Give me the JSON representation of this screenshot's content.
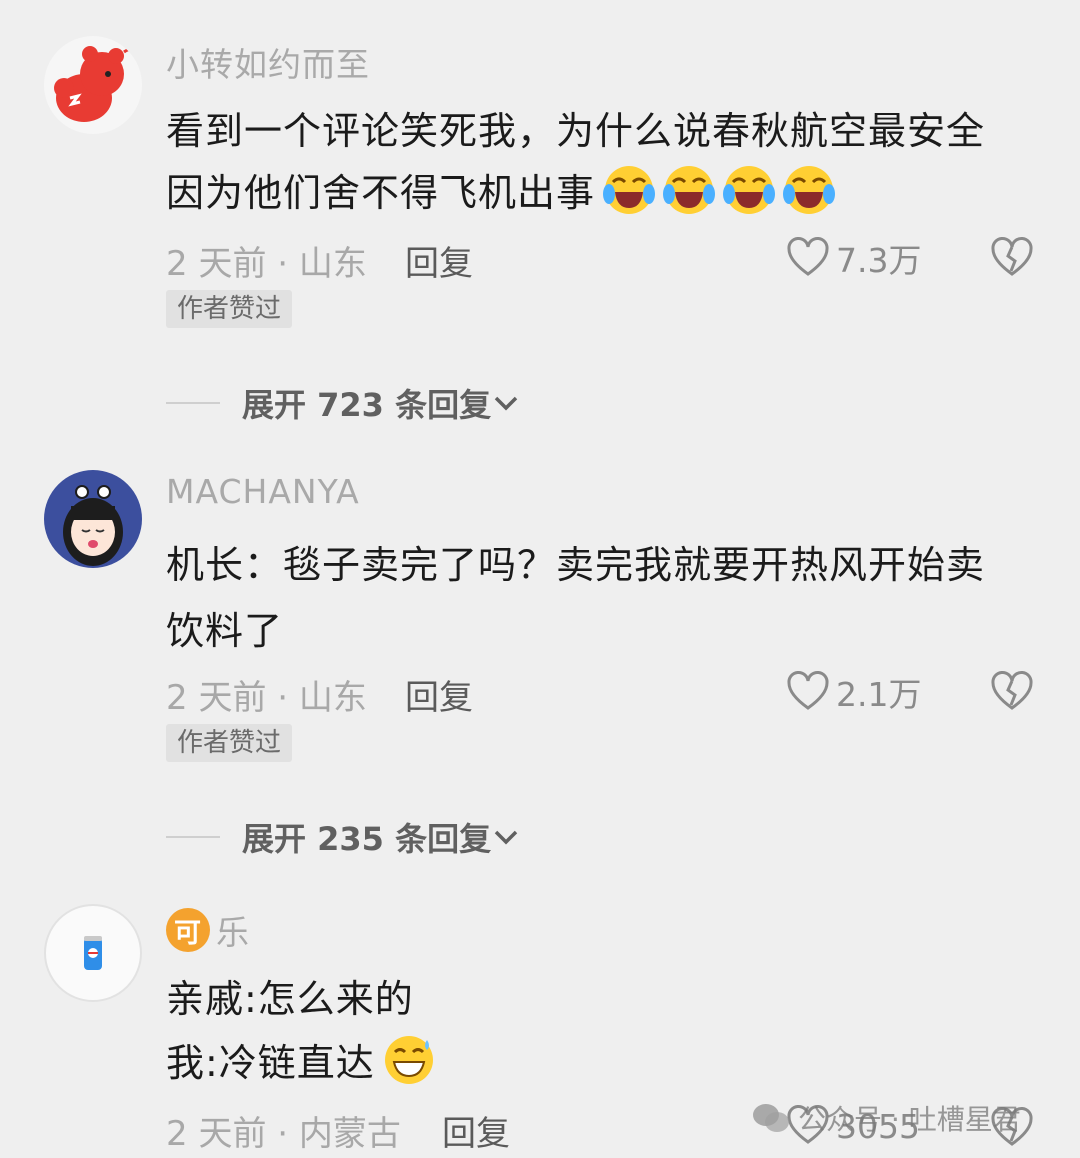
{
  "comments": [
    {
      "username": "小转如约而至",
      "lines": [
        "看到一个评论笑死我，为什么说春秋航空最安全",
        "因为他们舍不得飞机出事"
      ],
      "emoji_count": 4,
      "meta": "2 天前 · 山东",
      "reply_label": "回复",
      "likes": "7.3万",
      "badge": "作者赞过",
      "expand_label": "展开 723 条回复"
    },
    {
      "username": "MACHANYA",
      "lines": [
        "机长：毯子卖完了吗？卖完我就要开热风开始卖",
        "饮料了"
      ],
      "meta": "2 天前 · 山东",
      "reply_label": "回复",
      "likes": "2.1万",
      "badge": "作者赞过",
      "expand_label": "展开 235 条回复"
    },
    {
      "username_badge": "可",
      "username": "乐",
      "lines": [
        "亲戚:怎么来的",
        "我:冷链直达"
      ],
      "meta": "2 天前 · 内蒙古",
      "reply_label": "回复",
      "likes": "3055"
    }
  ],
  "watermark": "公众号 · 吐槽星君",
  "colors": {
    "background": "#efefef",
    "username": "#a9a9a9",
    "text": "#1b1b1b",
    "meta": "#a8a8a8",
    "badge_bg": "#e1e1e1"
  },
  "icons": {
    "like": "heart-outline-icon",
    "dislike": "broken-heart-icon",
    "expand": "chevron-down-icon",
    "emoji_laugh": "laughing-crying-emoji",
    "emoji_grin": "sweat-grin-emoji"
  }
}
